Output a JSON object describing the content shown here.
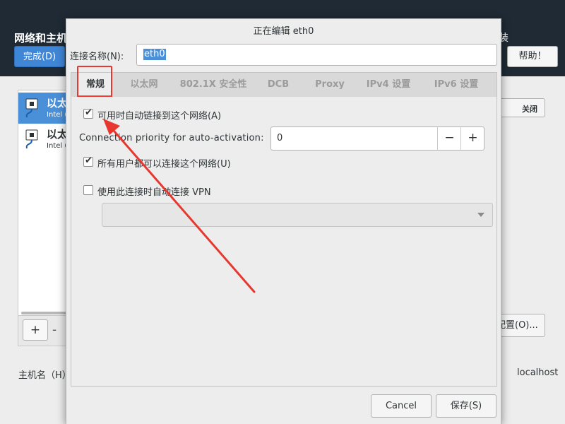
{
  "background": {
    "title": "网络和主机",
    "right_title": "装",
    "done_label": "完成(D)",
    "help_label": "帮助！",
    "devices": [
      {
        "name": "以太",
        "sub": "Intel (",
        "selected": true
      },
      {
        "name": "以太",
        "sub": "Intel (",
        "selected": false
      }
    ],
    "add_label": "+",
    "remove_label": "-",
    "toggle_label": "关闭",
    "config_label": "配置(O)...",
    "hostname_label": "主机名（H）",
    "hostname_colon": ":",
    "hostname_value": "localhost"
  },
  "dialog": {
    "title": "正在编辑 eth0",
    "connection_name_label": "连接名称(N):",
    "connection_name_value": "eth0",
    "tabs": [
      {
        "label": "常规",
        "active": true
      },
      {
        "label": "以太网",
        "active": false
      },
      {
        "label": "802.1X 安全性",
        "active": false
      },
      {
        "label": "DCB",
        "active": false
      },
      {
        "label": "Proxy",
        "active": false
      },
      {
        "label": "IPv4 设置",
        "active": false
      },
      {
        "label": "IPv6 设置",
        "active": false
      }
    ],
    "general": {
      "auto_connect_label": "可用时自动链接到这个网络(A)",
      "auto_connect_checked": true,
      "priority_label": "Connection priority for auto-activation:",
      "priority_value": "0",
      "priority_minus": "−",
      "priority_plus": "+",
      "all_users_label": "所有用户都可以连接这个网络(U)",
      "all_users_checked": true,
      "auto_vpn_label": "使用此连接时自动连接 VPN",
      "auto_vpn_checked": false
    },
    "cancel_label": "Cancel",
    "save_label": "保存(S)"
  },
  "colors": {
    "accent": "#4a90d9",
    "annotation": "#e8372e",
    "header_bg": "#1f2a35"
  },
  "icons": {
    "device": "ethernet-cable-icon",
    "checkmark": "check-icon",
    "dropdown": "chevron-down-icon"
  }
}
